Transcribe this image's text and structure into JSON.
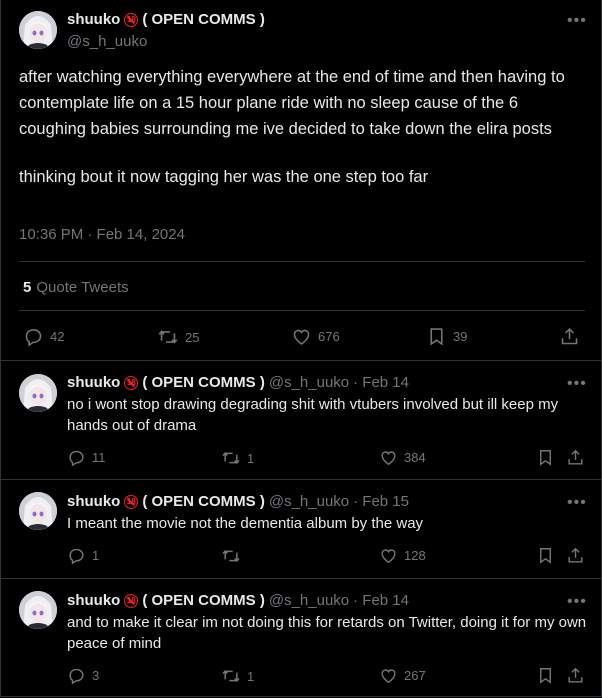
{
  "main": {
    "author_name": "shuuko",
    "author_badge": "18",
    "author_suffix": "( OPEN COMMS )",
    "handle": "@s_h_uuko",
    "body_p1": "after watching everything everywhere at the end of time  and then having to contemplate life on a 15 hour plane ride with no sleep cause of the 6 coughing babies surrounding me ive decided to take down the elira posts",
    "body_p2": "thinking bout it now tagging her was the one step too far",
    "timestamp": "10:36 PM · Feb 14, 2024",
    "quote_count": "5",
    "quote_label": "Quote Tweets",
    "replies": "42",
    "reposts": "25",
    "likes": "676",
    "bookmarks": "39"
  },
  "replies": [
    {
      "name": "shuuko",
      "suffix": "( OPEN COMMS )",
      "handle": "@s_h_uuko",
      "date": "· Feb 14",
      "text": "no i wont stop drawing degrading shit with vtubers involved but ill keep my hands out of drama",
      "replies": "11",
      "reposts": "1",
      "likes": "384"
    },
    {
      "name": "shuuko",
      "suffix": "( OPEN COMMS )",
      "handle": "@s_h_uuko",
      "date": "· Feb 15",
      "text": "I meant the movie not the dementia album by the way",
      "replies": "1",
      "reposts": "",
      "likes": "128"
    },
    {
      "name": "shuuko",
      "suffix": "( OPEN COMMS )",
      "handle": "@s_h_uuko",
      "date": "· Feb 14",
      "text": "and to make it clear im not doing this for retards on Twitter, doing it for my own peace of mind",
      "replies": "3",
      "reposts": "1",
      "likes": "267"
    }
  ],
  "icons": {
    "more": "more-dots-icon",
    "reply": "reply-bubble-icon",
    "repost": "repost-arrows-icon",
    "like": "heart-icon",
    "bookmark": "bookmark-icon",
    "share": "share-upload-icon"
  },
  "colors": {
    "background": "#000000",
    "text": "#e7e9ea",
    "muted": "#71767b",
    "border": "#2f3336",
    "badge": "#f4212e"
  }
}
